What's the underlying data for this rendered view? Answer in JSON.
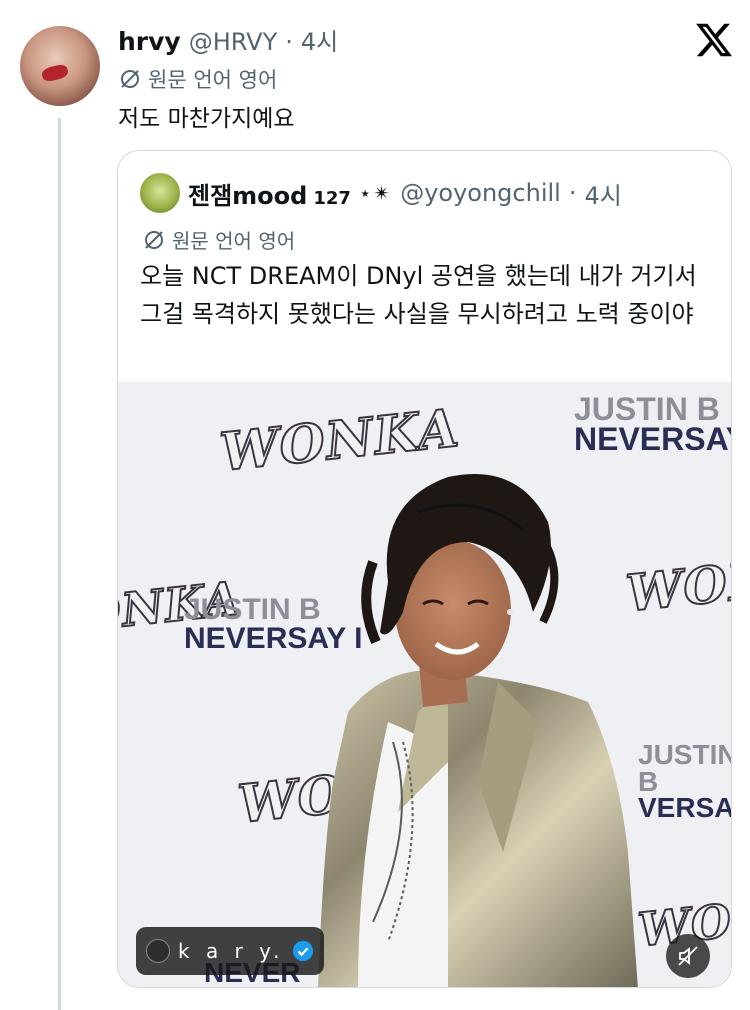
{
  "post": {
    "name": "hrvy",
    "handle": "@HRVY",
    "separator": "·",
    "time": "4시",
    "translate_label": "원문 언어 영어",
    "text": "저도 마찬가지예요"
  },
  "quoted_post": {
    "name": "젠잼mood",
    "name_suffix": "127",
    "sparkle": "⋆✴",
    "handle": "@yoyongchill",
    "separator": "·",
    "time": "4시",
    "translate_label": "원문 언어 영어",
    "text": "오늘 NCT DREAM이 DNyl 공연을 했는데 내가 거기서 그걸 목격하지 못했다는 사실을 무시하려고 노력 중이야",
    "media": {
      "backdrop_logos": [
        "WONKA",
        "WONKA",
        "WONKA",
        "WONKA",
        "WONKA"
      ],
      "backdrop_text_top": [
        "JUSTIN B",
        "NEVERSAY"
      ],
      "backdrop_text_mid": [
        "JUSTIN B",
        "NEVERSAY I"
      ],
      "backdrop_text_right": [
        "JUSTIN B",
        "VERSA"
      ],
      "backdrop_text_bottom": "NEVER",
      "creator_label": "k a r y.",
      "icons": [
        "verified-badge-icon",
        "muted-speaker-icon"
      ]
    }
  },
  "colors": {
    "text_primary": "#0f1419",
    "text_secondary": "#536471",
    "border": "#cfd9de",
    "verified": "#1d9bf0"
  }
}
